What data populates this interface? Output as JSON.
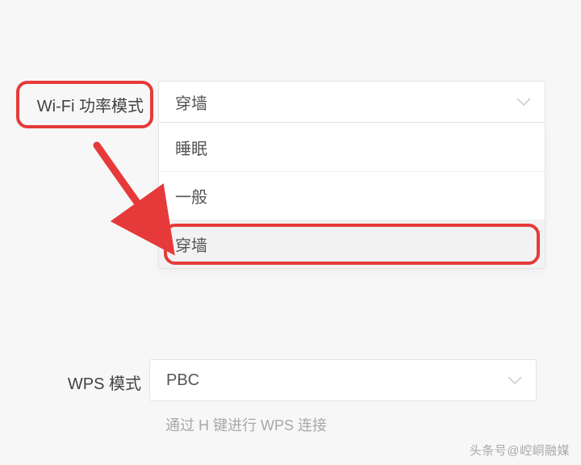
{
  "wifi_power": {
    "label": "Wi-Fi 功率模式",
    "selected": "穿墙",
    "options": [
      "睡眠",
      "一般",
      "穿墙"
    ]
  },
  "wps_mode": {
    "label": "WPS 模式",
    "selected": "PBC",
    "helper": "通过 H 键进行 WPS 连接"
  },
  "annotation": {
    "highlight_color": "#e63a3a"
  },
  "watermark": "头条号@崆峒融媒"
}
